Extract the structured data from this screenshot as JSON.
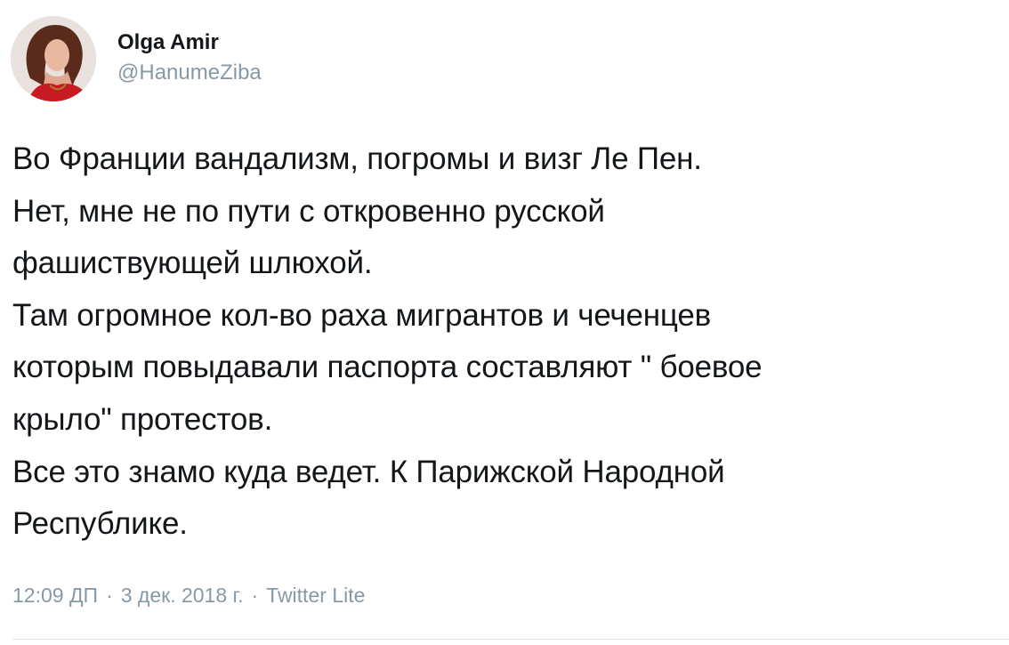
{
  "author": {
    "display_name": "Olga Amir",
    "handle": "@HanumeZiba",
    "avatar_icon": "user-avatar-photo"
  },
  "tweet": {
    "lines": [
      "Во Франции вандализм, погромы и визг Ле Пен.",
      "Нет, мне не по пути с откровенно русской",
      "фашиствующей шлюхой.",
      "Там огромное кол-во раха мигрантов и  чеченцев",
      "которым повыдавали паспорта составляют \" боевое",
      "крыло\" протестов.",
      "Все это знамо куда ведет. К Парижской Народной",
      "Республике."
    ]
  },
  "meta": {
    "time": "12:09 ДП",
    "date": "3 дек. 2018 г.",
    "source": "Twitter Lite",
    "separator": "·"
  },
  "colors": {
    "text": "#14171a",
    "secondary": "#8899a6",
    "divider": "#e1e8ed"
  }
}
